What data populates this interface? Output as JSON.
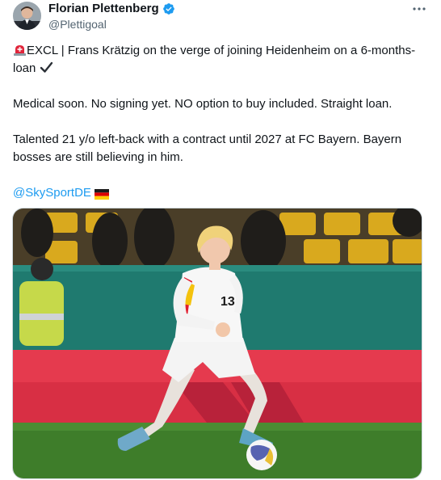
{
  "author": {
    "name": "Florian Plettenberg",
    "handle": "@Plettigoal",
    "verified": true
  },
  "tweet": {
    "line1_text": "EXCL | Frans Krätzig on the verge of joining Heidenheim on a 6-months-loan",
    "line1_prefix_icon": "siren-icon",
    "line1_suffix_icon": "checkmark-icon",
    "line2_text": "Medical soon. No signing yet. NO option to buy included. Straight loan.",
    "line3_text": "Talented 21 y/o left-back with a contract until 2027 at FC Bayern. Bayern bosses are still believing in him.",
    "mention": "@SkySportDE",
    "mention_suffix_icon": "germany-flag-icon"
  },
  "media": {
    "icon": "football-player-photo",
    "shirt_number": "13"
  },
  "colors": {
    "link": "#1d9bf0",
    "text": "#0f1419",
    "secondary": "#536471",
    "verified": "#1d9bf0"
  },
  "menu_icon": "more-dots-icon"
}
